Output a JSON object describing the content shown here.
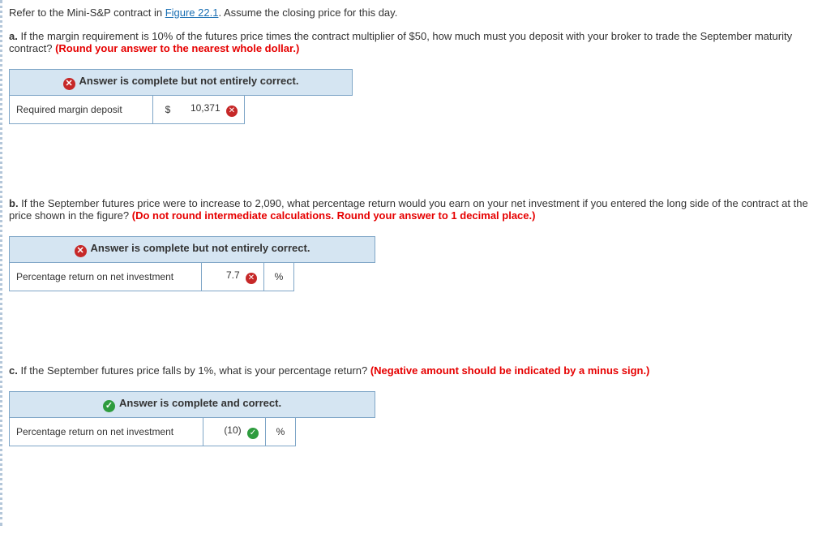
{
  "intro": {
    "prefix": "Refer to the Mini-S&P contract in ",
    "link": "Figure 22.1",
    "suffix": ". Assume the closing price for this day."
  },
  "qa": {
    "label": "a.",
    "text": " If the margin requirement is 10% of the futures price times the contract multiplier of $50, how much must you deposit with your broker to trade the September maturity contract? ",
    "hint": "(Round your answer to the nearest whole dollar.)",
    "feedback": "Answer is complete but not entirely correct.",
    "row_label": "Required margin deposit",
    "unit": "$",
    "value": "10,371"
  },
  "qb": {
    "label": "b.",
    "text": " If the September futures price were to increase to 2,090, what percentage return would you earn on your net investment if you entered the long side of the contract at the price shown in the figure? ",
    "hint": "(Do not round intermediate calculations. Round your answer to 1 decimal place.)",
    "feedback": "Answer is complete but not entirely correct.",
    "row_label": "Percentage return on net investment",
    "value": "7.7",
    "unit": "%"
  },
  "qc": {
    "label": "c.",
    "text": " If the September futures price falls by 1%, what is your percentage return? ",
    "hint": "(Negative amount should be indicated by a minus sign.)",
    "feedback": "Answer is complete and correct.",
    "row_label": "Percentage return on net investment",
    "value": "(10)",
    "unit": "%"
  },
  "icons": {
    "x": "✕",
    "check": "✓"
  }
}
